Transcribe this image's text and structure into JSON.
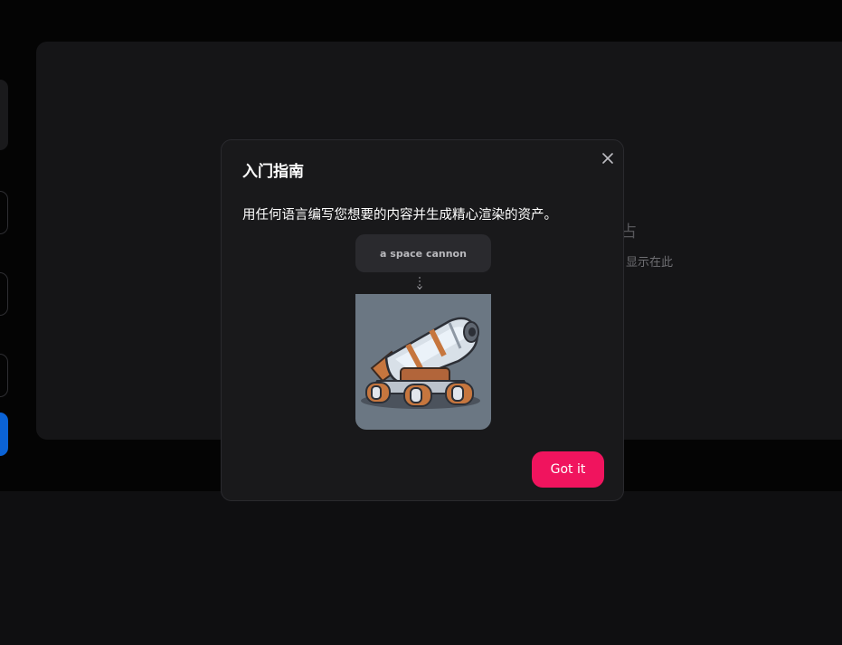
{
  "background": {
    "caption": "显示在此",
    "glyph": "占"
  },
  "modal": {
    "title": "入门指南",
    "description": "用任何语言编写您想要的内容并生成精心渲染的资产。",
    "prompt_example": "a space cannon",
    "preview_subject": "cartoon space cannon on wheels",
    "confirm_label": "Got it",
    "close_icon": "close-icon",
    "accent_color": "#f0145e"
  }
}
